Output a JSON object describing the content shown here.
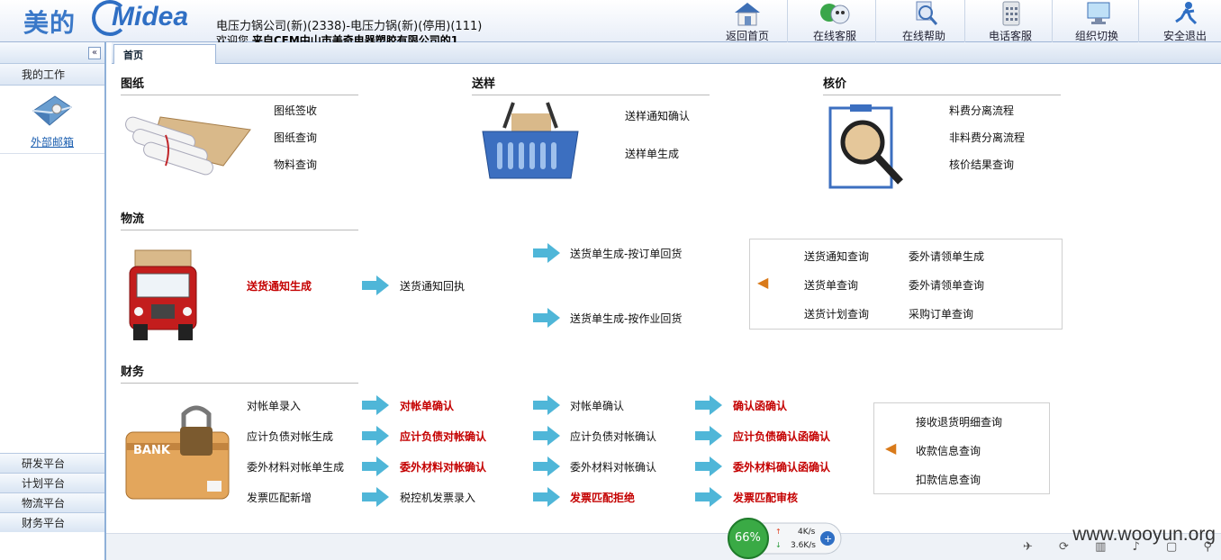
{
  "header": {
    "logo_cn": "美的",
    "logo_en": "Midea",
    "company": "电压力锅公司(新)(2338)-电压力锅(新)(停用)(111)",
    "welcome_prefix": "欢迎您,",
    "welcome_name": "来自CEM中山市美奇电器塑胶有限公司的1",
    "nav": [
      {
        "label": "返回首页",
        "icon": "home-icon"
      },
      {
        "label": "在线客服",
        "icon": "online-service-icon"
      },
      {
        "label": "在线帮助",
        "icon": "help-icon"
      },
      {
        "label": "电话客服",
        "icon": "phone-icon"
      },
      {
        "label": "组织切换",
        "icon": "org-switch-icon"
      },
      {
        "label": "安全退出",
        "icon": "logout-icon"
      }
    ]
  },
  "sidebar": {
    "collapse": "«",
    "title": "我的工作",
    "mail": "外部邮箱",
    "platforms": [
      "研发平台",
      "计划平台",
      "物流平台",
      "财务平台"
    ]
  },
  "tabs": [
    "首页"
  ],
  "sections": {
    "drawings": {
      "title": "图纸",
      "links": [
        "图纸签收",
        "图纸查询",
        "物料查询"
      ]
    },
    "samples": {
      "title": "送样",
      "links": [
        "送样通知确认",
        "送样单生成"
      ]
    },
    "pricing": {
      "title": "核价",
      "links": [
        "料费分离流程",
        "非料费分离流程",
        "核价结果查询"
      ]
    },
    "logistics": {
      "title": "物流",
      "start": "送货通知生成",
      "receipt": "送货通知回执",
      "by_order": "送货单生成-按订单回货",
      "by_job": "送货单生成-按作业回货",
      "panel": [
        "送货通知查询",
        "委外请领单生成",
        "送货单查询",
        "委外请领单查询",
        "送货计划查询",
        "采购订单查询"
      ]
    },
    "finance": {
      "title": "财务",
      "rows": [
        [
          "对帐单录入",
          "对帐单确认",
          "对帐单确认",
          "确认函确认"
        ],
        [
          "应计负债对帐生成",
          "应计负债对帐确认",
          "应计负债对帐确认",
          "应计负债确认函确认"
        ],
        [
          "委外材料对帐单生成",
          "委外材料对帐确认",
          "委外材料对帐确认",
          "委外材料确认函确认"
        ],
        [
          "发票匹配新增",
          "税控机发票录入",
          "发票匹配拒绝",
          "发票匹配审核"
        ]
      ],
      "panel": [
        "接收退货明细查询",
        "收款信息查询",
        "扣款信息查询"
      ]
    }
  },
  "tray": {
    "percent": "66%",
    "up": "4K/s",
    "down": "3.6K/s",
    "watermark": "www.wooyun.org"
  },
  "colors": {
    "accent": "#2f6fc4",
    "red_link": "#c40000",
    "arrow": "#4fb6d8"
  }
}
